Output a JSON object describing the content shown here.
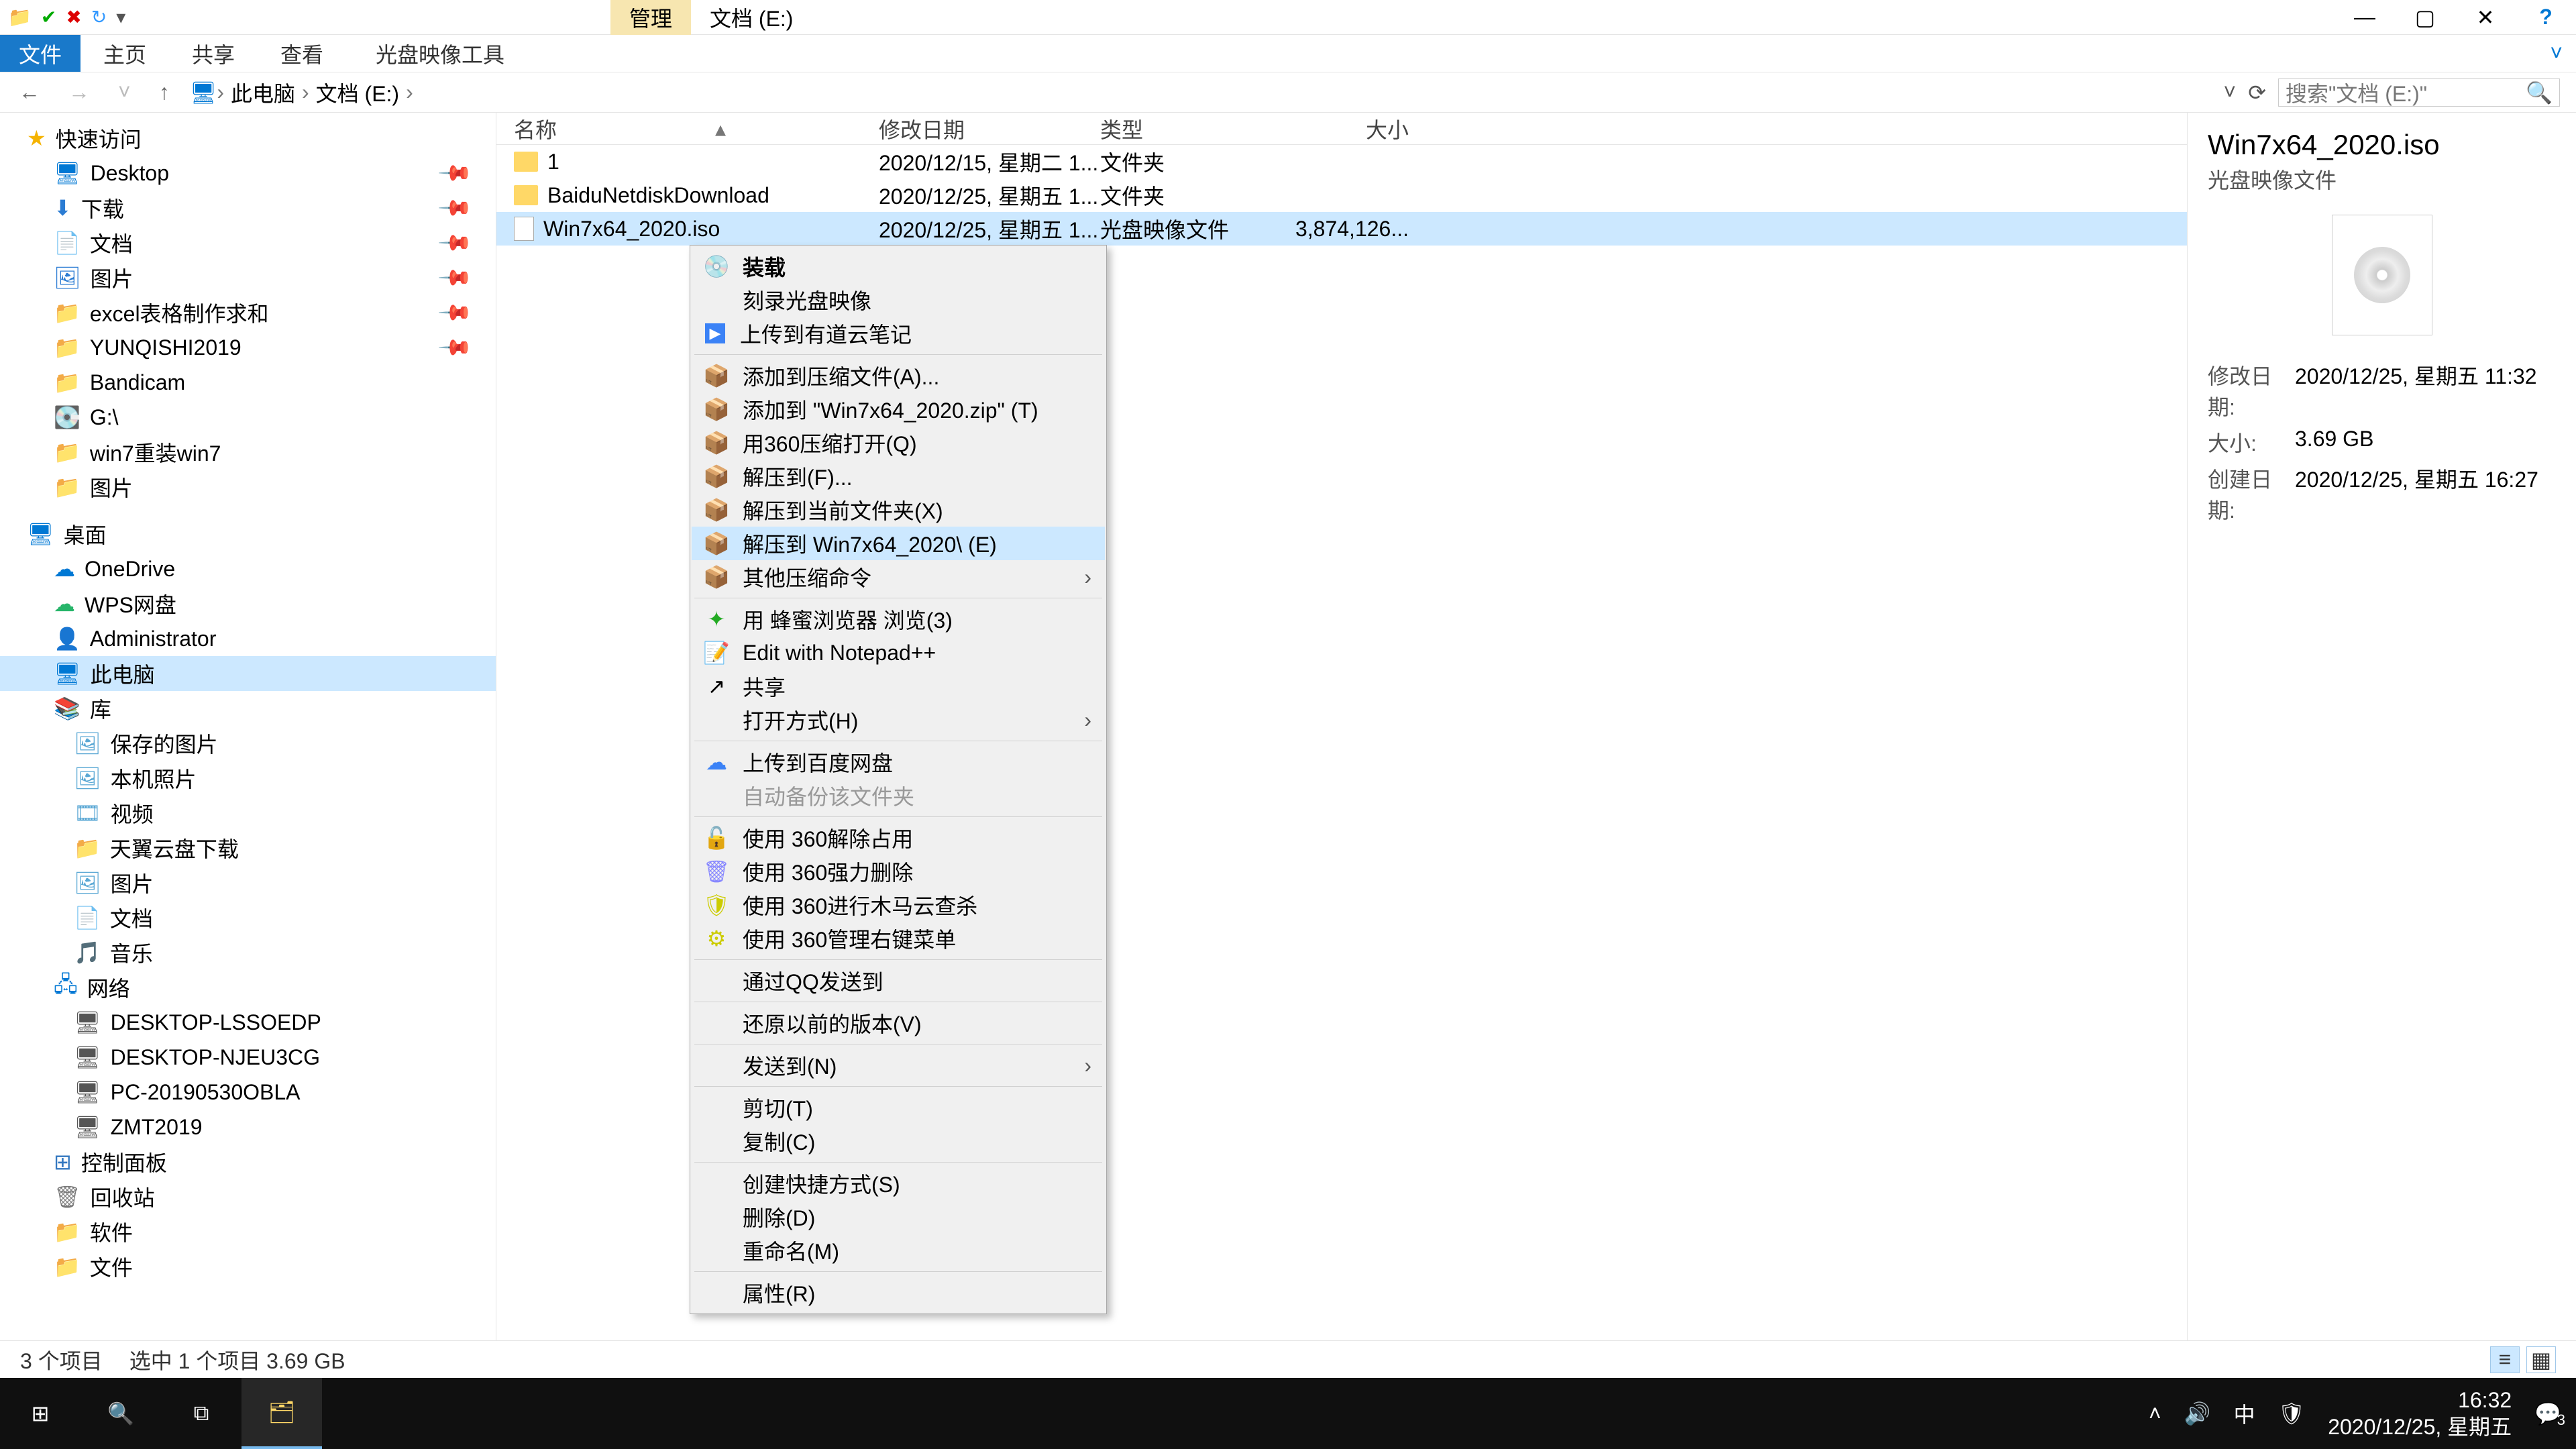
{
  "titlebar": {
    "context_tab": "管理",
    "drive_label": "文档 (E:)"
  },
  "ribbon": {
    "file": "文件",
    "home": "主页",
    "share": "共享",
    "view": "查看",
    "isotools": "光盘映像工具"
  },
  "breadcrumb": {
    "b0": "此电脑",
    "b1": "文档 (E:)"
  },
  "search": {
    "placeholder": "搜索\"文档 (E:)\""
  },
  "nav": {
    "quick": "快速访问",
    "desktop": "Desktop",
    "downloads": "下载",
    "documents": "文档",
    "pictures": "图片",
    "excel": "excel表格制作求和",
    "yunqishi": "YUNQISHI2019",
    "bandicam": "Bandicam",
    "gdrive": "G:\\",
    "win7r": "win7重装win7",
    "pictures2": "图片",
    "desktop_section": "桌面",
    "onedrive": "OneDrive",
    "wps": "WPS网盘",
    "admin": "Administrator",
    "thispc": "此电脑",
    "libraries": "库",
    "savedpics": "保存的图片",
    "camera": "本机照片",
    "videos": "视频",
    "tianyi": "天翼云盘下载",
    "pics3": "图片",
    "docs2": "文档",
    "music": "音乐",
    "network": "网络",
    "pc1": "DESKTOP-LSSOEDP",
    "pc2": "DESKTOP-NJEU3CG",
    "pc3": "PC-20190530OBLA",
    "pc4": "ZMT2019",
    "cpanel": "控制面板",
    "recycle": "回收站",
    "soft": "软件",
    "files": "文件"
  },
  "columns": {
    "name": "名称",
    "date": "修改日期",
    "type": "类型",
    "size": "大小"
  },
  "rows": [
    {
      "name": "1",
      "date": "2020/12/15, 星期二 1...",
      "type": "文件夹",
      "size": ""
    },
    {
      "name": "BaiduNetdiskDownload",
      "date": "2020/12/25, 星期五 1...",
      "type": "文件夹",
      "size": ""
    },
    {
      "name": "Win7x64_2020.iso",
      "date": "2020/12/25, 星期五 1...",
      "type": "光盘映像文件",
      "size": "3,874,126..."
    }
  ],
  "context": {
    "mount": "装载",
    "burn": "刻录光盘映像",
    "youdao": "上传到有道云笔记",
    "addarc": "添加到压缩文件(A)...",
    "addzip": "添加到 \"Win7x64_2020.zip\" (T)",
    "open360": "用360压缩打开(Q)",
    "extractto": "解压到(F)...",
    "extracthere": "解压到当前文件夹(X)",
    "extractname": "解压到 Win7x64_2020\\ (E)",
    "othercomp": "其他压缩命令",
    "beebrowser": "用 蜂蜜浏览器 浏览(3)",
    "notepadpp": "Edit with Notepad++",
    "share": "共享",
    "openwith": "打开方式(H)",
    "baidu": "上传到百度网盘",
    "autobak": "自动备份该文件夹",
    "unlock360": "使用 360解除占用",
    "forcedel": "使用 360强力删除",
    "trojan": "使用 360进行木马云查杀",
    "manage360": "使用 360管理右键菜单",
    "qqsend": "通过QQ发送到",
    "restore": "还原以前的版本(V)",
    "sendto": "发送到(N)",
    "cut": "剪切(T)",
    "copy": "复制(C)",
    "shortcut": "创建快捷方式(S)",
    "delete": "删除(D)",
    "rename": "重命名(M)",
    "props": "属性(R)"
  },
  "preview": {
    "filename": "Win7x64_2020.iso",
    "filetype": "光盘映像文件",
    "mod_label": "修改日期:",
    "mod_val": "2020/12/25, 星期五 11:32",
    "size_label": "大小:",
    "size_val": "3.69 GB",
    "created_label": "创建日期:",
    "created_val": "2020/12/25, 星期五 16:27"
  },
  "status": {
    "total": "3 个项目",
    "sel": "选中 1 个项目  3.69 GB"
  },
  "tray": {
    "time": "16:32",
    "date": "2020/12/25, 星期五",
    "ime": "中",
    "count": "3"
  }
}
